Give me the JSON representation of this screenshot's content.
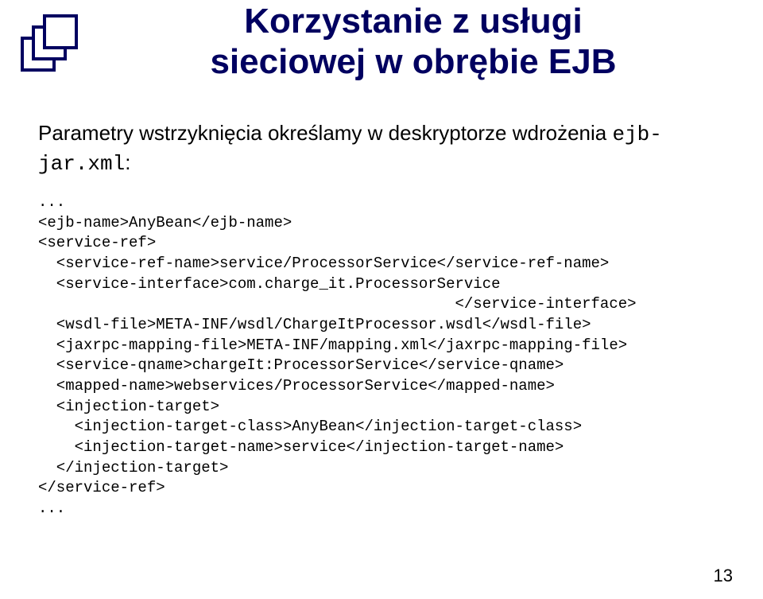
{
  "title": {
    "line1": "Korzystanie z usługi",
    "line2": "sieciowej w obrębie EJB"
  },
  "intro": "Parametry wstrzyknięcia określamy w deskryptorze wdrożenia ",
  "intro_code": "ejb-jar.xml",
  "intro_suffix": ":",
  "code": "...\n<ejb-name>AnyBean</ejb-name>\n<service-ref>\n  <service-ref-name>service/ProcessorService</service-ref-name>\n  <service-interface>com.charge_it.ProcessorService\n                                              </service-interface>\n  <wsdl-file>META-INF/wsdl/ChargeItProcessor.wsdl</wsdl-file>\n  <jaxrpc-mapping-file>META-INF/mapping.xml</jaxrpc-mapping-file>\n  <service-qname>chargeIt:ProcessorService</service-qname>\n  <mapped-name>webservices/ProcessorService</mapped-name>\n  <injection-target>\n    <injection-target-class>AnyBean</injection-target-class>\n    <injection-target-name>service</injection-target-name>\n  </injection-target>\n</service-ref>\n...",
  "page_number": "13"
}
